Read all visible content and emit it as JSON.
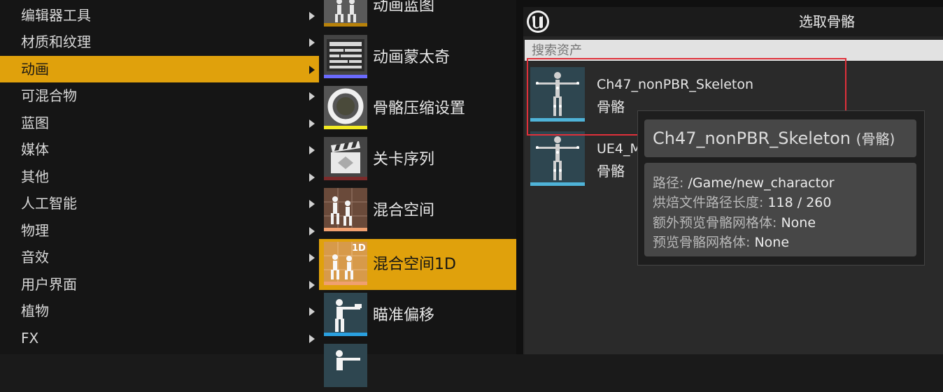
{
  "categories": [
    {
      "label": "编辑器工具",
      "active": false
    },
    {
      "label": "材质和纹理",
      "active": false
    },
    {
      "label": "动画",
      "active": true
    },
    {
      "label": "可混合物",
      "active": false
    },
    {
      "label": "蓝图",
      "active": false
    },
    {
      "label": "媒体",
      "active": false
    },
    {
      "label": "其他",
      "active": false
    },
    {
      "label": "人工智能",
      "active": false
    },
    {
      "label": "物理",
      "active": false
    },
    {
      "label": "音效",
      "active": false
    },
    {
      "label": "用户界面",
      "active": false
    },
    {
      "label": "植物",
      "active": false
    },
    {
      "label": "FX",
      "active": false
    }
  ],
  "asset_types": [
    {
      "label": "动画蓝图",
      "icon": "animation-blueprint-icon",
      "color": "#e0a10c"
    },
    {
      "label": "动画蒙太奇",
      "icon": "animation-montage-icon",
      "color": "#6a6aff"
    },
    {
      "label": "骨骼压缩设置",
      "icon": "bone-compression-icon",
      "color": "#f2ea22"
    },
    {
      "label": "关卡序列",
      "icon": "level-sequence-icon",
      "color": "#7a2a2a"
    },
    {
      "label": "混合空间",
      "icon": "blend-space-icon",
      "color": "#f0a070"
    },
    {
      "label": "混合空间1D",
      "icon": "blend-space-1d-icon",
      "color": "#f0a070",
      "badge": "1D"
    },
    {
      "label": "瞄准偏移",
      "icon": "aim-offset-icon",
      "color": "#2aa0e0"
    },
    {
      "label": "",
      "icon": "aim-offset-1d-icon",
      "color": "#2aa0e0"
    }
  ],
  "picker": {
    "title": "选取骨骼",
    "search_placeholder": "搜索资产",
    "assets": [
      {
        "name": "Ch47_nonPBR_Skeleton",
        "type": "骨骼"
      },
      {
        "name": "UE4_M",
        "type": "骨骼"
      }
    ]
  },
  "tooltip": {
    "name": "Ch47_nonPBR_Skeleton",
    "type": "(骨骼)",
    "rows": [
      {
        "key": "路径:",
        "value": "/Game/new_charactor"
      },
      {
        "key": "烘焙文件路径长度:",
        "value": "118 / 260"
      },
      {
        "key": "额外预览骨骼网格体:",
        "value": "None"
      },
      {
        "key": "预览骨骼网格体:",
        "value": "None"
      }
    ]
  },
  "colors": {
    "accent": "#e0a10c",
    "highlight": "#e0303a",
    "thumb_bar": "#4fb3d8"
  }
}
